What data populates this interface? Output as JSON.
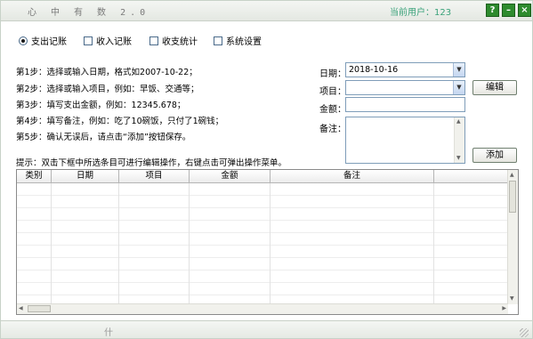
{
  "window": {
    "title": "心 中 有 数  2.0",
    "user_label": "当前用户：123",
    "help_label": "?",
    "minimize_label": "–",
    "close_label": "×"
  },
  "tabs": [
    {
      "label": "支出记账",
      "selected": true
    },
    {
      "label": "收入记账",
      "selected": false
    },
    {
      "label": "收支统计",
      "selected": false
    },
    {
      "label": "系统设置",
      "selected": false
    }
  ],
  "steps": [
    "第1步：选择或输入日期，格式如2007-10-22；",
    "第2步：选择或输入项目，例如：早饭、交通等；",
    "第3步：填写支出金额，例如：12345.678；",
    "第4步：填写备注，例如：吃了10碗饭，只付了1碗钱；",
    "第5步：确认无误后，请点击“添加”按钮保存。"
  ],
  "form": {
    "date_label": "日期：",
    "date_value": "2018-10-16",
    "item_label": "项目：",
    "item_value": "",
    "amount_label": "金额：",
    "amount_value": "",
    "note_label": "备注：",
    "note_value": "",
    "edit_button": "编辑",
    "add_button": "添加"
  },
  "hint": "提示：双击下框中所选条目可进行编辑操作，右键点击可弹出操作菜单。",
  "grid": {
    "columns": [
      "类别",
      "日期",
      "项目",
      "金额",
      "备注",
      ""
    ],
    "rows": []
  },
  "statusbar": {
    "text": "什"
  },
  "colors": {
    "accent_green": "#2e8b2e",
    "user_text": "#3aa27a"
  },
  "icons": [
    "help-icon",
    "minimize-icon",
    "close-icon",
    "dropdown-arrow-icon",
    "resize-grip-icon"
  ]
}
